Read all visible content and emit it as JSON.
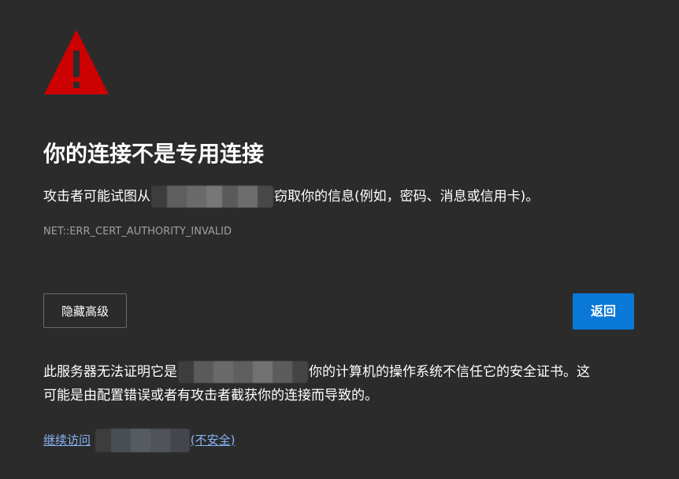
{
  "warning": {
    "icon": "warning-triangle-icon",
    "icon_color": "#cc0000"
  },
  "title": "你的连接不是专用连接",
  "description": {
    "before": "攻击者可能试图从",
    "after": "窃取你的信息(例如，密码、消息或信用卡)。"
  },
  "error_code": "NET::ERR_CERT_AUTHORITY_INVALID",
  "buttons": {
    "hide_advanced": "隐藏高级",
    "back": "返回"
  },
  "details": {
    "line1_before": "此服务器无法证明它是",
    "line1_after": "你的计算机的操作系统不信任它的安全证书。这",
    "line2": "可能是由配置错误或者有攻击者截获你的连接而导致的。"
  },
  "proceed_link": {
    "before": "继续访问",
    "after": "(不安全)"
  },
  "colors": {
    "background": "#2b2b2b",
    "accent": "#0a78d7",
    "link": "#8ab4f8"
  }
}
